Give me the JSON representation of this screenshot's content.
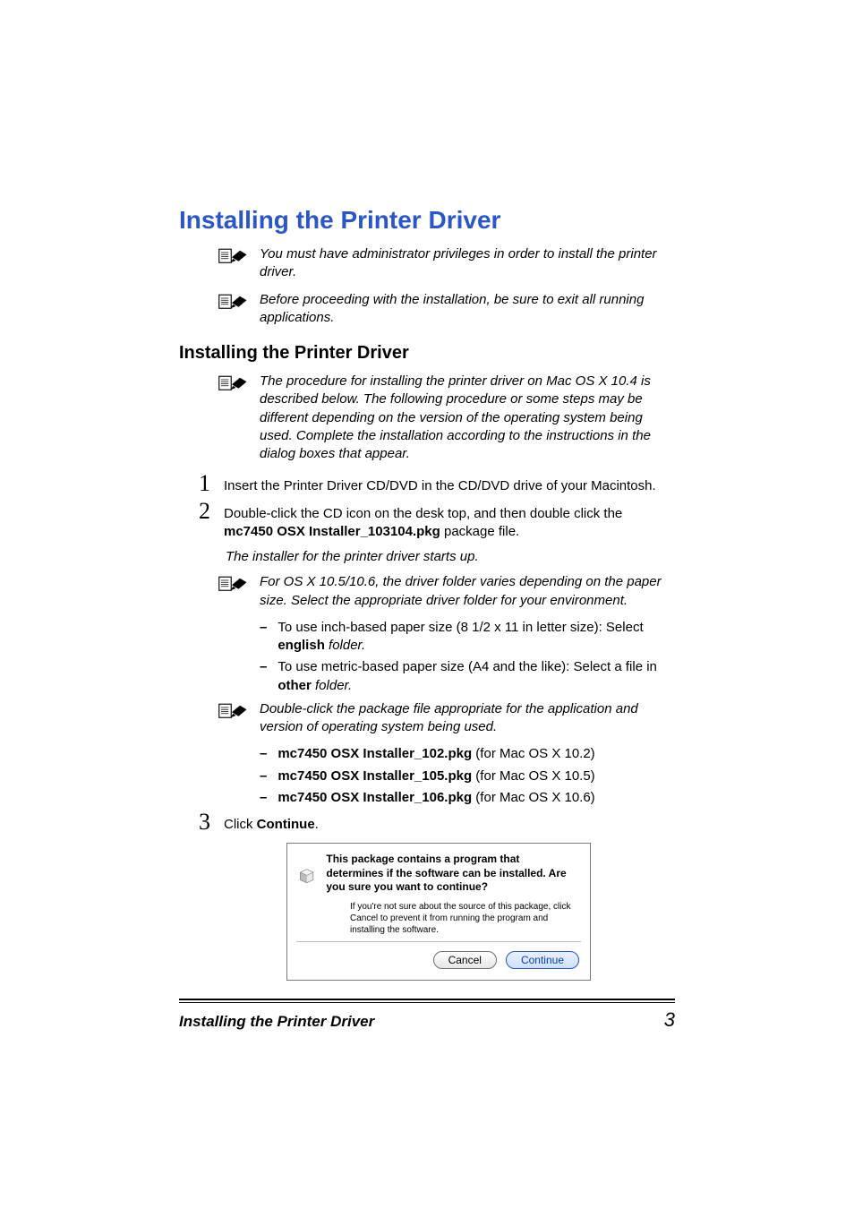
{
  "main_heading": "Installing the Printer Driver",
  "note_admin": "You must have administrator privileges in order to install the printer driver.",
  "note_exit": "Before proceeding with the installation, be sure to exit all running applications.",
  "sub_heading": "Installing the Printer Driver",
  "note_procedure": "The procedure for installing the printer driver on Mac OS X 10.4 is described below. The following procedure or some steps may be different depending on the version of the operating system being used. Complete the installation according to the instructions in the dialog boxes that appear.",
  "step1_num": "1",
  "step1_text": "Insert the Printer Driver CD/DVD in the CD/DVD drive of your Macintosh.",
  "step2_num": "2",
  "step2_pre": "Double-click the CD icon on the desk top, and then double click the ",
  "step2_pkg": "mc7450 OSX Installer_103104.pkg",
  "step2_post": " package file.",
  "step2_result": "The installer for the printer driver starts up.",
  "note_osx1056": "For OS X 10.5/10.6, the driver folder varies depending on the paper size. Select the appropriate driver folder for your environment.",
  "bullet_inch_pre": "To use inch-based paper size (8 1/2 x 11 in letter size): Select ",
  "bullet_inch_bold": "english",
  "bullet_inch_post": " folder.",
  "bullet_metric_pre": "To use metric-based paper size (A4 and the like): Select a file in ",
  "bullet_metric_bold": "other",
  "bullet_metric_post": " folder.",
  "note_dblclick": "Double-click the package file appropriate for the application and version of operating system being used.",
  "pkg102_bold": "mc7450 OSX Installer_102.pkg",
  "pkg102_post": " (for Mac OS X 10.2)",
  "pkg105_bold": "mc7450 OSX Installer_105.pkg",
  "pkg105_post": " (for Mac OS X 10.5)",
  "pkg106_bold": "mc7450 OSX Installer_106.pkg",
  "pkg106_post": " (for Mac OS X 10.6)",
  "step3_num": "3",
  "step3_pre": "Click ",
  "step3_bold": "Continue",
  "step3_post": ".",
  "dialog": {
    "title": "This package contains a program that determines if the software can be installed.  Are you sure you want to continue?",
    "sub": "If you're not sure about the source of this package, click Cancel to prevent it from running the program and installing the software.",
    "cancel": "Cancel",
    "continue": "Continue"
  },
  "footer_title": "Installing the Printer Driver",
  "footer_page": "3",
  "dash": "–"
}
